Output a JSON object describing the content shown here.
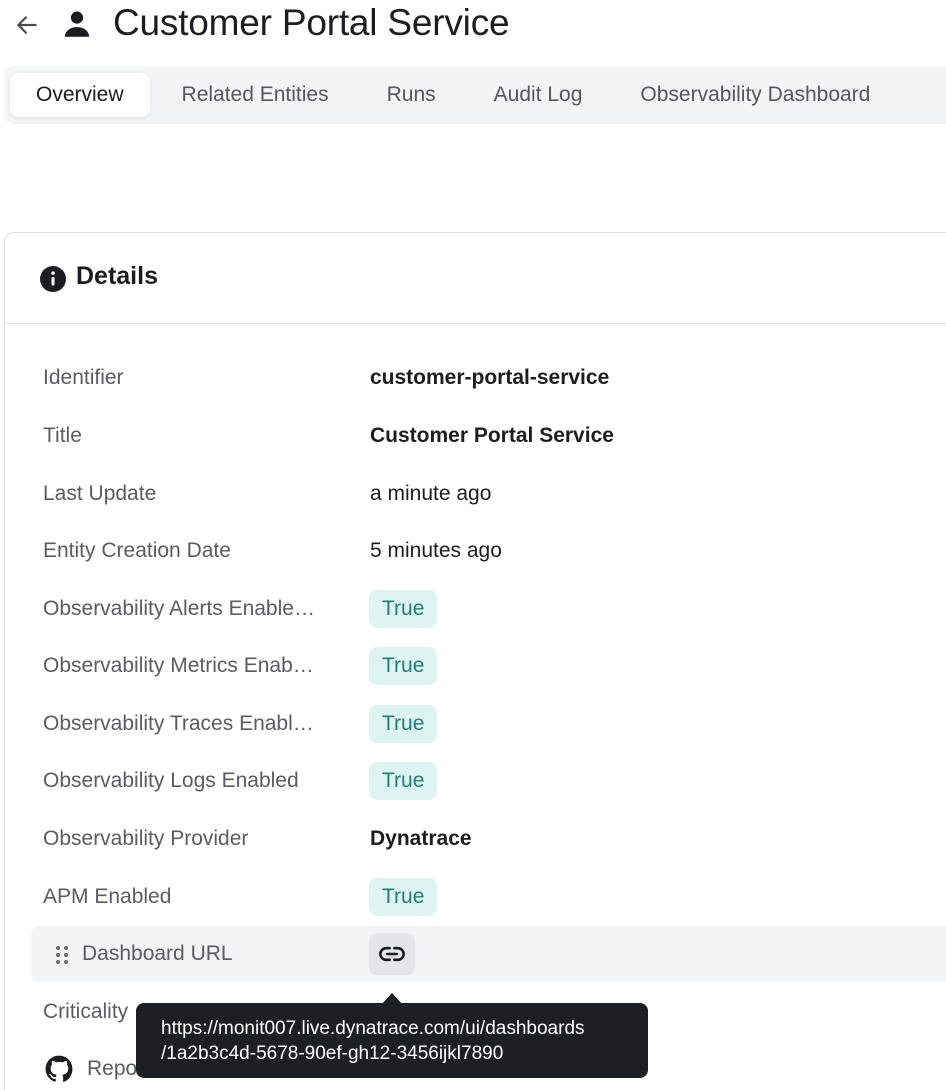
{
  "header": {
    "title": "Customer Portal Service",
    "back_icon": "arrow-left-icon",
    "entity_icon": "person-icon"
  },
  "tabs": [
    {
      "label": "Overview",
      "active": true
    },
    {
      "label": "Related Entities",
      "active": false
    },
    {
      "label": "Runs",
      "active": false
    },
    {
      "label": "Audit Log",
      "active": false
    },
    {
      "label": "Observability Dashboard",
      "active": false
    }
  ],
  "details": {
    "title": "Details",
    "icon": "info-icon",
    "rows": [
      {
        "label": "Identifier",
        "value": "customer-portal-service"
      },
      {
        "label": "Title",
        "value": "Customer Portal Service"
      },
      {
        "label": "Last Update",
        "value": "a minute ago"
      },
      {
        "label": "Entity Creation Date",
        "value": "5 minutes ago"
      },
      {
        "label": "Observability Alerts Enable…",
        "value": "True"
      },
      {
        "label": "Observability Metrics Enab…",
        "value": "True"
      },
      {
        "label": "Observability Traces Enabl…",
        "value": "True"
      },
      {
        "label": "Observability Logs Enabled",
        "value": "True"
      },
      {
        "label": "Observability Provider",
        "value": "Dynatrace"
      },
      {
        "label": "APM Enabled",
        "value": "True"
      },
      {
        "label": "Dashboard URL",
        "icon": "link-icon"
      },
      {
        "label": "Criticality"
      },
      {
        "label": "Repo",
        "icon": "github-icon"
      }
    ]
  },
  "tooltip": {
    "line1": "https://monit007.live.dynatrace.com/ui/dashboards",
    "line2": "/1a2b3c4d-5678-90ef-gh12-3456ijkl7890"
  },
  "colors": {
    "badge_bg": "#ddf4f2",
    "badge_text": "#1f7f77",
    "tooltip_bg": "#1e1f24",
    "tab_bar_bg": "#f3f4f6"
  }
}
